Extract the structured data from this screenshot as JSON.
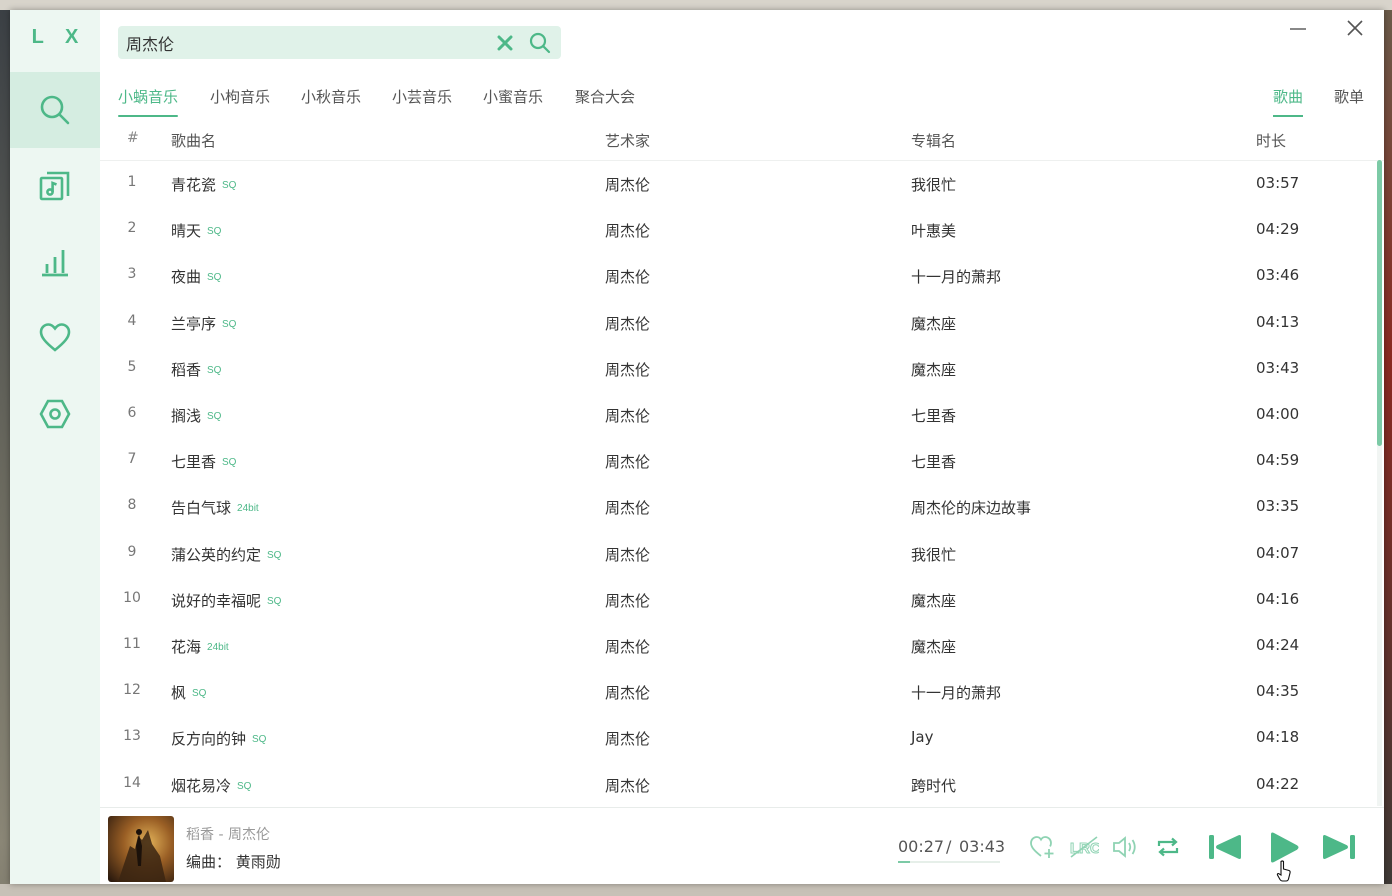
{
  "app": {
    "logo": "L X"
  },
  "sidebar": {
    "items": [
      {
        "name": "search",
        "icon": "search-icon",
        "active": true
      },
      {
        "name": "song-list",
        "icon": "music-list-icon",
        "active": false
      },
      {
        "name": "leaderboard",
        "icon": "bar-chart-icon",
        "active": false
      },
      {
        "name": "my-list",
        "icon": "heart-icon",
        "active": false
      },
      {
        "name": "settings",
        "icon": "hexagon-settings-icon",
        "active": false
      }
    ]
  },
  "search": {
    "value": "周杰伦",
    "placeholder": ""
  },
  "source_tabs": [
    {
      "label": "小蜗音乐",
      "active": true
    },
    {
      "label": "小枸音乐",
      "active": false
    },
    {
      "label": "小秋音乐",
      "active": false
    },
    {
      "label": "小芸音乐",
      "active": false
    },
    {
      "label": "小蜜音乐",
      "active": false
    },
    {
      "label": "聚合大会",
      "active": false
    }
  ],
  "type_tabs": [
    {
      "label": "歌曲",
      "active": true
    },
    {
      "label": "歌单",
      "active": false
    }
  ],
  "table": {
    "headers": {
      "num": "#",
      "name": "歌曲名",
      "artist": "艺术家",
      "album": "专辑名",
      "duration": "时长"
    },
    "rows": [
      {
        "num": "1",
        "name": "青花瓷",
        "quality": "SQ",
        "artist": "周杰伦",
        "album": "我很忙",
        "duration": "03:57"
      },
      {
        "num": "2",
        "name": "晴天",
        "quality": "SQ",
        "artist": "周杰伦",
        "album": "叶惠美",
        "duration": "04:29"
      },
      {
        "num": "3",
        "name": "夜曲",
        "quality": "SQ",
        "artist": "周杰伦",
        "album": "十一月的萧邦",
        "duration": "03:46"
      },
      {
        "num": "4",
        "name": "兰亭序",
        "quality": "SQ",
        "artist": "周杰伦",
        "album": "魔杰座",
        "duration": "04:13"
      },
      {
        "num": "5",
        "name": "稻香",
        "quality": "SQ",
        "artist": "周杰伦",
        "album": "魔杰座",
        "duration": "03:43"
      },
      {
        "num": "6",
        "name": "搁浅",
        "quality": "SQ",
        "artist": "周杰伦",
        "album": "七里香",
        "duration": "04:00"
      },
      {
        "num": "7",
        "name": "七里香",
        "quality": "SQ",
        "artist": "周杰伦",
        "album": "七里香",
        "duration": "04:59"
      },
      {
        "num": "8",
        "name": "告白气球",
        "quality": "24bit",
        "artist": "周杰伦",
        "album": "周杰伦的床边故事",
        "duration": "03:35"
      },
      {
        "num": "9",
        "name": "蒲公英的约定",
        "quality": "SQ",
        "artist": "周杰伦",
        "album": "我很忙",
        "duration": "04:07"
      },
      {
        "num": "10",
        "name": "说好的幸福呢",
        "quality": "SQ",
        "artist": "周杰伦",
        "album": "魔杰座",
        "duration": "04:16"
      },
      {
        "num": "11",
        "name": "花海",
        "quality": "24bit",
        "artist": "周杰伦",
        "album": "魔杰座",
        "duration": "04:24"
      },
      {
        "num": "12",
        "name": "枫",
        "quality": "SQ",
        "artist": "周杰伦",
        "album": "十一月的萧邦",
        "duration": "04:35"
      },
      {
        "num": "13",
        "name": "反方向的钟",
        "quality": "SQ",
        "artist": "周杰伦",
        "album": "Jay",
        "duration": "04:18"
      },
      {
        "num": "14",
        "name": "烟花易冷",
        "quality": "SQ",
        "artist": "周杰伦",
        "album": "跨时代",
        "duration": "04:22"
      }
    ]
  },
  "player": {
    "now_playing": "稻香 - 周杰伦",
    "lyric_line": "编曲：  黄雨勋",
    "time_current": "00:27",
    "time_separator": "/",
    "time_total": "03:43",
    "progress": 0.12,
    "controls": [
      "heart-add-icon",
      "lyric-icon",
      "volume-icon",
      "repeat-icon",
      "previous-icon",
      "play-icon",
      "next-icon"
    ]
  },
  "colors": {
    "accent": "#4db888",
    "accent_light": "#e0f2e9",
    "sidebar_bg": "#edf7f2",
    "active_nav_bg": "#d5ede1"
  }
}
